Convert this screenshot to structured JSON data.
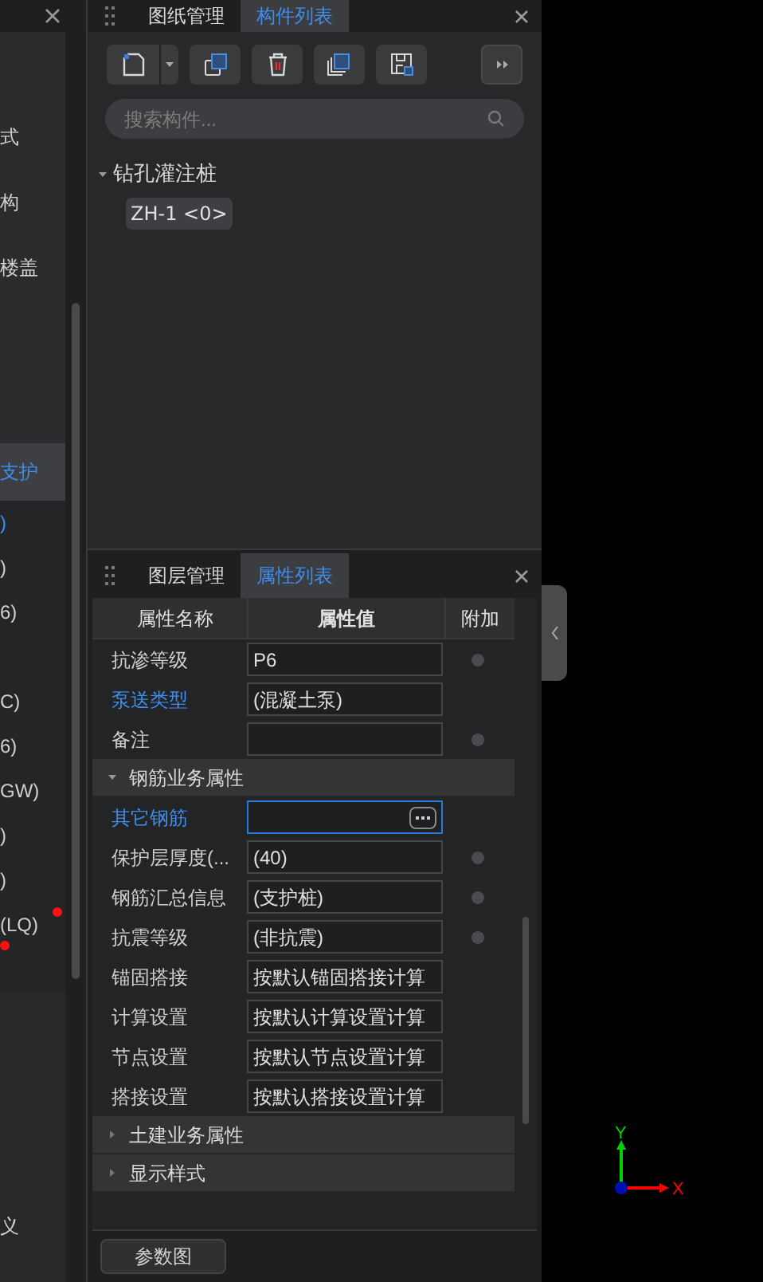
{
  "left_panel": {
    "top_items": [
      {
        "text": "式"
      },
      {
        "text": "构"
      },
      {
        "text": "楼盖"
      }
    ],
    "selected_item": {
      "text": "支护",
      "selected": true
    },
    "sub_items": [
      {
        "text": ")",
        "highlighted": true,
        "flag": false
      },
      {
        "text": ")",
        "highlighted": false,
        "flag": false
      },
      {
        "text": "6)",
        "highlighted": false,
        "flag": false
      },
      {
        "text": "C)",
        "highlighted": false,
        "flag": false
      },
      {
        "text": "6)",
        "highlighted": false,
        "flag": false
      },
      {
        "text": "GW)",
        "highlighted": false,
        "flag": false
      },
      {
        "text": ")",
        "highlighted": false,
        "flag": false
      },
      {
        "text": ")",
        "highlighted": false,
        "flag": false
      },
      {
        "text": "(LQ)",
        "highlighted": false,
        "flag": true
      },
      {
        "flag": true
      }
    ],
    "bottom_item": {
      "text": "义"
    }
  },
  "component_panel": {
    "tabs": [
      {
        "label": "图纸管理",
        "selected": false
      },
      {
        "label": "构件列表",
        "selected": true
      }
    ],
    "search": {
      "placeholder": "搜索构件..."
    },
    "tree": [
      {
        "label": "钻孔灌注桩",
        "expanded": true,
        "children": [
          {
            "label": "ZH-1 <0>",
            "selected": true
          }
        ]
      }
    ]
  },
  "property_panel": {
    "tabs": [
      {
        "label": "图层管理",
        "selected": false
      },
      {
        "label": "属性列表",
        "selected": true
      }
    ],
    "columns": [
      "属性名称",
      "属性值",
      "附加"
    ],
    "rows": [
      {
        "kind": "property",
        "name": "抗渗等级",
        "value": "P6",
        "highlighted": false,
        "attach": true,
        "focused": false
      },
      {
        "kind": "property",
        "name": "泵送类型",
        "value": "(混凝土泵)",
        "highlighted": true,
        "attach": false,
        "focused": false
      },
      {
        "kind": "property",
        "name": "备注",
        "highlighted": false,
        "attach": true,
        "focused": false
      },
      {
        "kind": "group",
        "name": "钢筋业务属性",
        "expanded": true
      },
      {
        "kind": "property",
        "name": "其它钢筋",
        "highlighted": true,
        "attach": false,
        "focused": true
      },
      {
        "kind": "property",
        "name": "保护层厚度(...",
        "value": "(40)",
        "highlighted": false,
        "attach": true,
        "focused": false
      },
      {
        "kind": "property",
        "name": "钢筋汇总信息",
        "value": "(支护桩)",
        "highlighted": false,
        "attach": true,
        "focused": false
      },
      {
        "kind": "property",
        "name": "抗震等级",
        "value": "(非抗震)",
        "highlighted": false,
        "attach": true,
        "focused": false
      },
      {
        "kind": "property",
        "name": "锚固搭接",
        "value": "按默认锚固搭接计算",
        "highlighted": false,
        "attach": false,
        "focused": false
      },
      {
        "kind": "property",
        "name": "计算设置",
        "value": "按默认计算设置计算",
        "highlighted": false,
        "attach": false,
        "focused": false
      },
      {
        "kind": "property",
        "name": "节点设置",
        "value": "按默认节点设置计算",
        "highlighted": false,
        "attach": false,
        "focused": false
      },
      {
        "kind": "property",
        "name": "搭接设置",
        "value": "按默认搭接设置计算",
        "highlighted": false,
        "attach": false,
        "focused": false
      },
      {
        "kind": "group",
        "name": "土建业务属性",
        "expanded": false
      },
      {
        "kind": "group",
        "name": "显示样式",
        "expanded": false
      }
    ],
    "footer_button": "参数图"
  },
  "canvas": {
    "axis_x": "X",
    "axis_y": "Y"
  }
}
